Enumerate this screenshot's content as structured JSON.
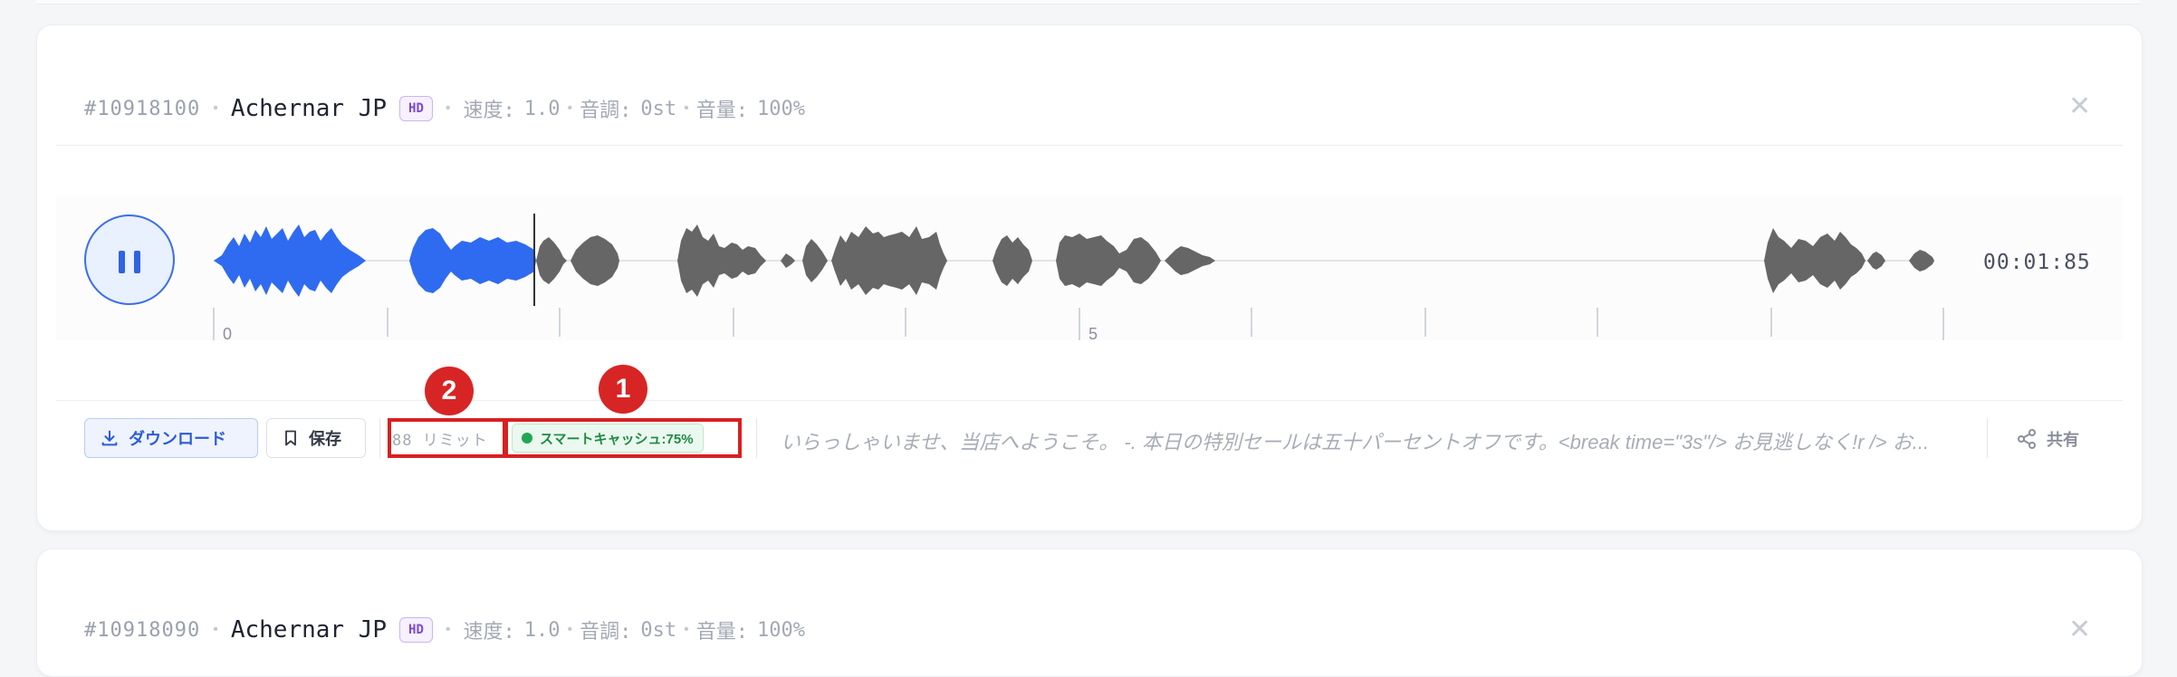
{
  "entries": [
    {
      "id": "#10918100",
      "voice": "Achernar JP",
      "quality_badge": "HD",
      "params": {
        "speed_label": "速度:",
        "speed_value": "1.0",
        "pitch_label": "音調:",
        "pitch_value": "0st",
        "volume_label": "音量:",
        "volume_value": "100%"
      },
      "player": {
        "state": "playing",
        "time": "00:01:85",
        "progress_fraction": 0.18,
        "ticks": [
          "0",
          "5"
        ]
      },
      "actions": {
        "download_label": "ダウンロード",
        "save_label": "保存",
        "limit_text": "88 リミット",
        "cache_text": "スマートキャッシュ:75%",
        "preview_text": "いらっしゃいませ、当店へようこそ。 -. 本日の特別セールは五十パーセントオフです。<break time=\"3s\"/> お見逃しなく!r /> お...",
        "share_label": "共有"
      },
      "annotations": [
        "1",
        "2"
      ]
    },
    {
      "id": "#10918090",
      "voice": "Achernar JP",
      "quality_badge": "HD",
      "params": {
        "speed_label": "速度:",
        "speed_value": "1.0",
        "pitch_label": "音調:",
        "pitch_value": "0st",
        "volume_label": "音量:",
        "volume_value": "100%"
      }
    }
  ],
  "colors": {
    "accent": "#2f63e0",
    "played_wave": "#2f6bf0",
    "unplayed_wave": "#666666",
    "cache_green": "#22a653",
    "annotation_red": "#d92020"
  },
  "icons": {
    "pause": "pause-icon",
    "download": "download-icon",
    "bookmark": "bookmark-icon",
    "share": "share-icon",
    "close": "close-icon"
  }
}
